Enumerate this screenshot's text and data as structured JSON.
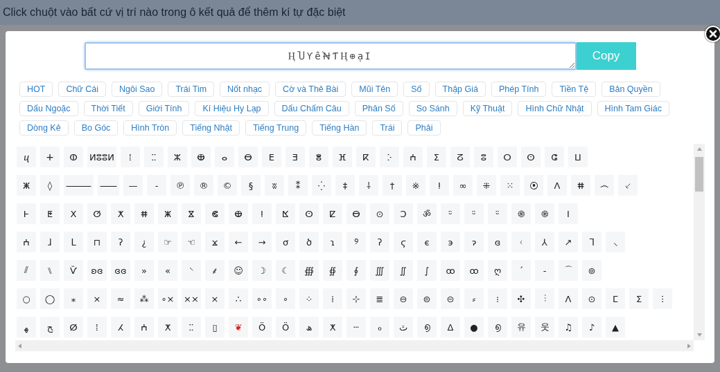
{
  "header": {
    "instruction": "Click chuột vào bất cứ vị trí nào trong ô kết quả để thêm kí tự đặc biệt"
  },
  "dialog": {
    "result": {
      "value": "ⱧႮƳềꞤƬⱧ⊕ạⵊ"
    },
    "copy_button": "Copy",
    "categories": [
      {
        "label": "HOT",
        "selected": false
      },
      {
        "label": "Chữ Cái",
        "selected": false
      },
      {
        "label": "Ngôi Sao",
        "selected": false
      },
      {
        "label": "Trái Tim",
        "selected": false
      },
      {
        "label": "Nốt nhạc",
        "selected": false
      },
      {
        "label": "Cờ và Thẻ Bài",
        "selected": false
      },
      {
        "label": "Mũi Tên",
        "selected": false
      },
      {
        "label": "Số",
        "selected": false
      },
      {
        "label": "Thập Giá",
        "selected": false
      },
      {
        "label": "Phép Tính",
        "selected": false
      },
      {
        "label": "Tiền Tệ",
        "selected": false
      },
      {
        "label": "Bản Quyền",
        "selected": false
      },
      {
        "label": "Dấu Ngoặc",
        "selected": false
      },
      {
        "label": "Thời Tiết",
        "selected": false
      },
      {
        "label": "Giới Tính",
        "selected": false
      },
      {
        "label": "Kí Hiệu Hy Lạp",
        "selected": false
      },
      {
        "label": "Dấu Chấm Câu",
        "selected": false
      },
      {
        "label": "Phân Số",
        "selected": false
      },
      {
        "label": "So Sánh",
        "selected": false
      },
      {
        "label": "Kỹ Thuật",
        "selected": false
      },
      {
        "label": "Hình Chữ Nhật",
        "selected": false
      },
      {
        "label": "Hình Tam Giác",
        "selected": false
      },
      {
        "label": "Dòng Kẻ",
        "selected": false
      },
      {
        "label": "Bo Góc",
        "selected": false
      },
      {
        "label": "Hình Tròn",
        "selected": false
      },
      {
        "label": "Tiếng Nhật",
        "selected": false
      },
      {
        "label": "Tiếng Trung",
        "selected": false
      },
      {
        "label": "Tiếng Hàn",
        "selected": false
      },
      {
        "label": "Trái",
        "selected": false
      },
      {
        "label": "Phải",
        "selected": false
      }
    ],
    "symbol_rows": [
      [
        "ⴗ",
        "ⵜ",
        "ⵀ",
        "ⵍⵓⵓⵍ",
        "ⵂ",
        "ⵆ",
        "ⵣ",
        "ⴲ",
        "ⴰ",
        "ⴱ",
        "ⴹ",
        "ⴺ",
        "ⴻ",
        "ⴼ",
        "ⴽ",
        "ⴾ",
        "ⵄ",
        "ⵉ",
        "ⵒ",
        "ⵓ",
        "ⵔ",
        "ⵙ",
        "ⵛ",
        "ⵡ"
      ],
      [
        "ⵥ",
        "◊",
        "⸻",
        "⸺",
        "—",
        "-",
        "℗",
        "®",
        "©",
        "§",
        "ʬ",
        "⁑",
        "⁛",
        "‡",
        "⸸",
        "†",
        "※",
        "ⵑ",
        "∞",
        "⁜",
        "⁙",
        "⦿",
        "ⴷ",
        "ⵌ",
        "෴",
        "⸔"
      ],
      [
        "Ⱶ",
        "ⵟ",
        "ⵝ",
        "ⵚ",
        "ⵅ",
        "ⵌ",
        "ⵥ",
        "ⴵ",
        "ⵞ",
        "ⴲ",
        "ⵑ",
        "ⴿ",
        "ⵙ",
        "ⵇ",
        "ⴱ",
        "⊙",
        "Ɔ",
        "ॐ",
        "ᵕ̈",
        "ᵕ̈",
        "ᵕ̈",
        "֍",
        "֎",
        "ⵏ"
      ],
      [
        "ⵄ",
        "ɺ",
        "ᒪ",
        "⊓",
        "ʔ",
        "¿",
        "☞",
        "☜",
        "ϫ",
        "←",
        "→",
        "ơ",
        "ծ",
        "ɿ",
        "୨",
        "ʔ",
        "ϛ",
        "є",
        "э",
        "ɂ",
        "ɞ",
        "ᚲ",
        "⅄",
        "↗",
        "ᒣ",
        "⸜"
      ],
      [
        "⫽",
        "⑊",
        "Ѷ",
        "ʚɞ",
        "ɞɞ",
        "»",
        "«",
        "⸌",
        "⸙",
        "☺",
        "☽",
        "☾",
        "∰",
        "∯",
        "∮",
        "∭",
        "∬",
        "∫",
        "ꝏ",
        "ꝏ",
        "ღ",
        "ˊ",
        "-",
        "⌒",
        "⊚"
      ],
      [
        "○",
        "◯",
        "⁎",
        "×",
        "≈",
        "⁂",
        "∘×",
        "××",
        "×",
        "∴",
        "∘∘",
        "∘",
        "⁘",
        "⁞",
        "⊹",
        "≣",
        "⊖",
        "⊜",
        "⊝",
        "⸗",
        "⁝",
        "✣",
        "⫶",
        "ⴷ",
        "⊙",
        "ⵎ",
        "ⵉ",
        "ⵗ"
      ],
      [
        "ﻬ",
        "ﺢ",
        "ⵁ",
        "ⵂ",
        "ⵃ",
        "ⵄ",
        "ⵅ",
        "ⵆ",
        "▯",
        {
          "char": "❦",
          "color": "#d42020"
        },
        "Ö",
        "Ö",
        "ﮪ",
        "ⵅ",
        "ⵈ",
        "ℴ",
        "ٿ",
        "൭",
        "ⵠ",
        "●",
        "൭",
        "유",
        "웃",
        "♫",
        "♪",
        "▲"
      ]
    ]
  }
}
